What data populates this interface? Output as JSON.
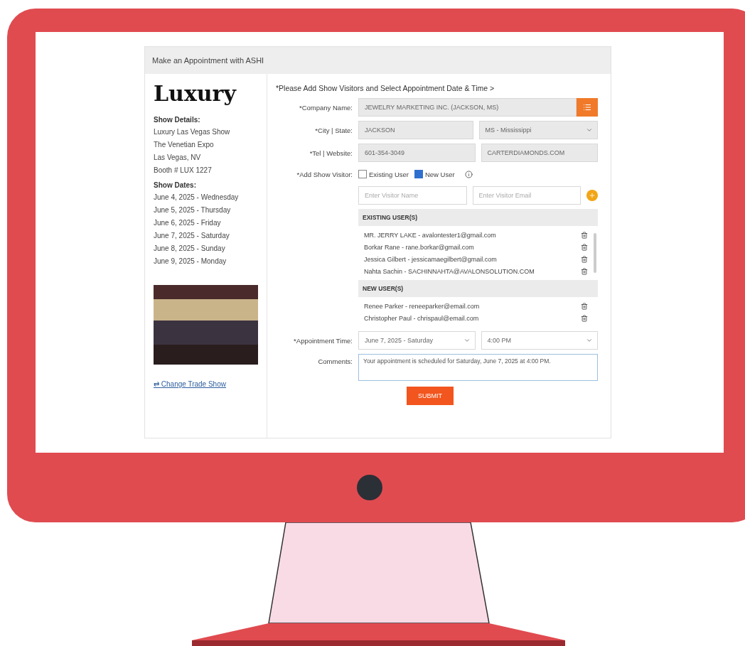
{
  "panel_title": "Make an Appointment with ASHI",
  "brand": "Luxury",
  "show_details": {
    "heading": "Show Details:",
    "lines": [
      "Luxury Las Vegas Show",
      "The Venetian Expo",
      "Las Vegas, NV",
      "Booth # LUX 1227"
    ]
  },
  "show_dates": {
    "heading": "Show Dates:",
    "dates": [
      "June 4, 2025 - Wednesday",
      "June 5, 2025 - Thursday",
      "June 6, 2025 - Friday",
      "June 7, 2025 - Saturday",
      "June 8, 2025 - Sunday",
      "June 9, 2025 - Monday"
    ]
  },
  "change_link": {
    "icon": "⇄",
    "label": "Change Trade Show"
  },
  "instruction": "*Please Add Show Visitors and Select Appointment Date & Time >",
  "company": {
    "label": "*Company Name:",
    "value": "JEWELRY MARKETING INC. (JACKSON, MS)"
  },
  "city_state": {
    "label": "*City | State:",
    "city": "JACKSON",
    "state": "MS - Mississippi"
  },
  "tel_website": {
    "label": "*Tel | Website:",
    "tel": "601-354-3049",
    "website": "CARTERDIAMONDS.COM"
  },
  "visitor": {
    "label": "*Add Show Visitor:",
    "options": [
      {
        "label": "Existing User",
        "checked": false
      },
      {
        "label": "New User",
        "checked": true
      }
    ],
    "name_placeholder": "Enter Visitor Name",
    "email_placeholder": "Enter Visitor Email"
  },
  "existing_users": {
    "heading": "EXISTING USER(S)",
    "items": [
      "MR. JERRY LAKE - avalontester1@gmail.com",
      "Borkar Rane - rane.borkar@gmail.com",
      "Jessica Gilbert - jessicamaegilbert@gmail.com",
      "Nahta Sachin - SACHINNAHTA@AVALONSOLUTION.COM"
    ]
  },
  "new_users": {
    "heading": "NEW USER(S)",
    "items": [
      "Renee Parker - reneeparker@email.com",
      "Christopher Paul - chrispaul@email.com"
    ]
  },
  "appointment": {
    "label": "*Appointment Time:",
    "date": "June 7, 2025 - Saturday",
    "time": "4:00 PM"
  },
  "comments": {
    "label": "Comments:",
    "value": "Your appointment is scheduled for Saturday, June 7, 2025 at 4:00 PM."
  },
  "submit": "SUBMIT"
}
